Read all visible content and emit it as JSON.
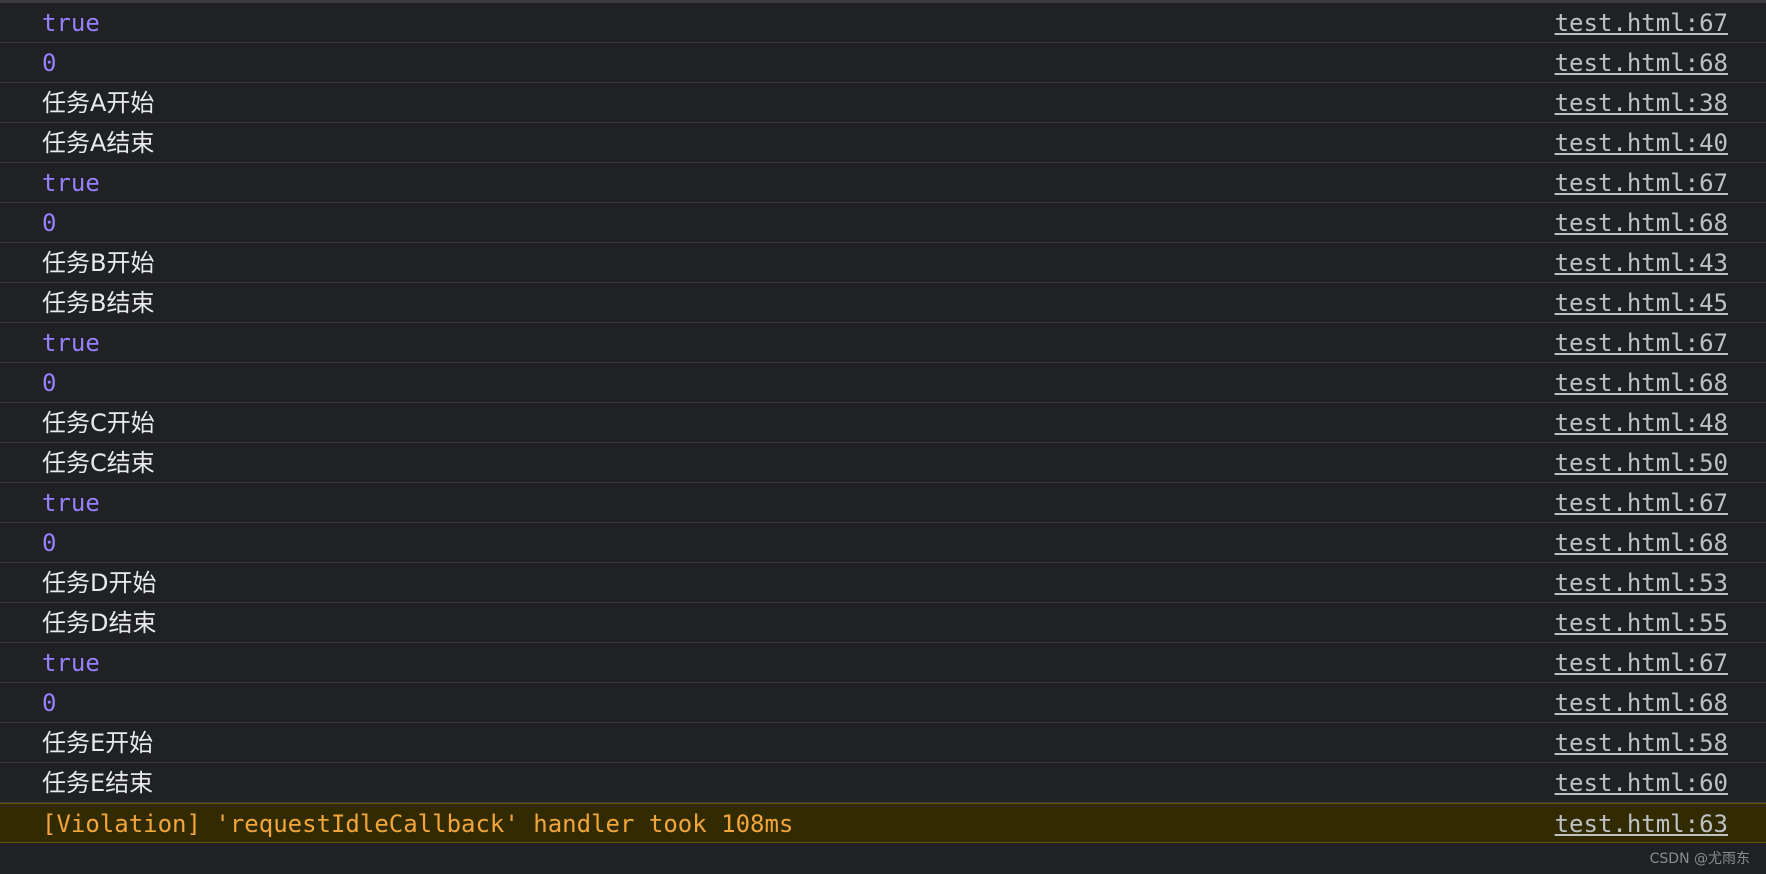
{
  "console": {
    "messages": [
      {
        "text": "true",
        "type": "bool",
        "source": "test.html:67"
      },
      {
        "text": "0",
        "type": "num",
        "source": "test.html:68"
      },
      {
        "text": "任务A开始",
        "type": "text",
        "source": "test.html:38"
      },
      {
        "text": "任务A结束",
        "type": "text",
        "source": "test.html:40"
      },
      {
        "text": "true",
        "type": "bool",
        "source": "test.html:67"
      },
      {
        "text": "0",
        "type": "num",
        "source": "test.html:68"
      },
      {
        "text": "任务B开始",
        "type": "text",
        "source": "test.html:43"
      },
      {
        "text": "任务B结束",
        "type": "text",
        "source": "test.html:45"
      },
      {
        "text": "true",
        "type": "bool",
        "source": "test.html:67"
      },
      {
        "text": "0",
        "type": "num",
        "source": "test.html:68"
      },
      {
        "text": "任务C开始",
        "type": "text",
        "source": "test.html:48"
      },
      {
        "text": "任务C结束",
        "type": "text",
        "source": "test.html:50"
      },
      {
        "text": "true",
        "type": "bool",
        "source": "test.html:67"
      },
      {
        "text": "0",
        "type": "num",
        "source": "test.html:68"
      },
      {
        "text": "任务D开始",
        "type": "text",
        "source": "test.html:53"
      },
      {
        "text": "任务D结束",
        "type": "text",
        "source": "test.html:55"
      },
      {
        "text": "true",
        "type": "bool",
        "source": "test.html:67"
      },
      {
        "text": "0",
        "type": "num",
        "source": "test.html:68"
      },
      {
        "text": "任务E开始",
        "type": "text",
        "source": "test.html:58"
      },
      {
        "text": "任务E结束",
        "type": "text",
        "source": "test.html:60"
      },
      {
        "text": "[Violation] 'requestIdleCallback' handler took 108ms",
        "type": "warn",
        "source": "test.html:63"
      }
    ]
  },
  "watermark": "CSDN @尤雨东",
  "colors": {
    "background": "#202124",
    "value_purple": "#9980ff",
    "text": "#e8eaed",
    "warning_text": "#f2a53a",
    "warning_bg": "#332b00",
    "link": "#bdc1c6"
  }
}
